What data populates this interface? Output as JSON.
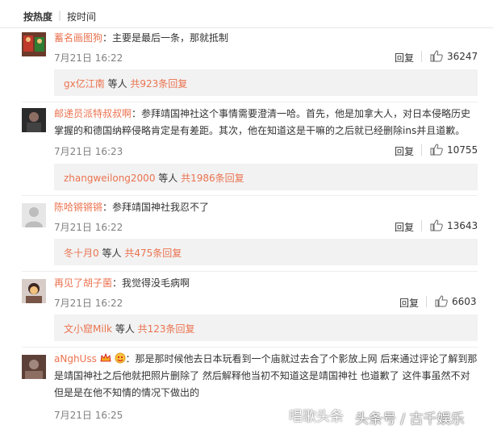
{
  "sort": {
    "hot": "按热度",
    "separator": "|",
    "time": "按时间"
  },
  "comments": [
    {
      "user": "蓄名画图狗",
      "sep": "：",
      "text": "主要是最后一条，那就抵制",
      "time": "7月21日 16:22",
      "reply": "回复",
      "likes": "36247",
      "sub": {
        "user": "gx亿江南",
        "suffix": "等人",
        "count": "共923条回复"
      }
    },
    {
      "user": "邮递员派特叔叔啊",
      "sep": "：",
      "text": "参拜靖国神社这个事情需要澄清一哈。首先，他是加拿大人，对日本侵略历史掌握的和德国纳粹侵略肯定是有差距。其次，他在知道这是干嘛的之后就已经删除ins并且道歉。",
      "time": "7月21日 16:23",
      "reply": "回复",
      "likes": "10755",
      "sub": {
        "user": "zhangweilong2000",
        "suffix": "等人",
        "count": "共1986条回复"
      }
    },
    {
      "user": "陈哈锵锵锵",
      "sep": "：",
      "text": "参拜靖国神社我忍不了",
      "time": "7月21日 16:22",
      "reply": "回复",
      "likes": "13643",
      "sub": {
        "user": "冬十月0",
        "suffix": "等人",
        "count": "共475条回复"
      }
    },
    {
      "user": "再见了胡子菌",
      "sep": "：",
      "text": "我觉得没毛病啊",
      "time": "7月21日 16:22",
      "reply": "回复",
      "likes": "6603",
      "sub": {
        "user": "文小窟Milk",
        "suffix": "等人",
        "count": "共123条回复"
      }
    },
    {
      "user": "aNghUss",
      "sep": "：",
      "text": "那是那时候他去日本玩看到一个庙就过去合了个影放上网 后来通过评论了解到那是靖国神社之后他就把照片删除了 然后解释他当初不知道这是靖国神社 也道歉了 这件事虽然不对 但是是在他不知情的情况下做出的",
      "time": "7月21日 16:25"
    }
  ],
  "watermark": {
    "left": "唱歌头条",
    "right": "头条号 / 古千娱乐"
  },
  "colors": {
    "username": "#eb7350",
    "subbox_bg": "#f2f2f2",
    "meta": "#808080"
  },
  "icons": [
    "thumbs-up-icon",
    "avatar",
    "crown-icon",
    "emoji-icon"
  ]
}
